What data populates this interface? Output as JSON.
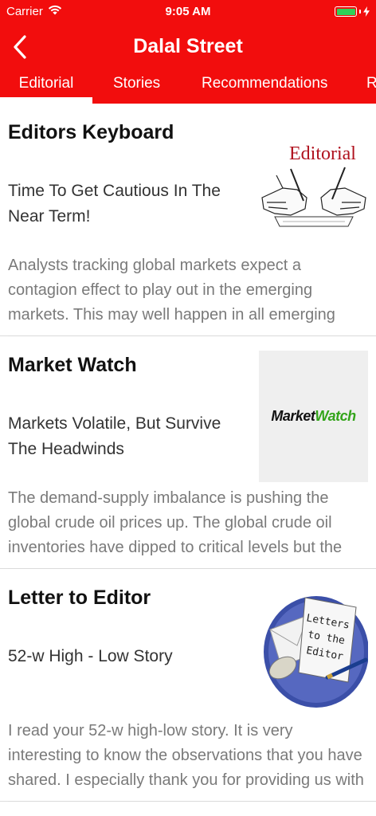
{
  "status_bar": {
    "carrier": "Carrier",
    "time": "9:05 AM"
  },
  "header": {
    "title": "Dalal Street",
    "background_color": "#f20d0d"
  },
  "tabs": [
    {
      "label": "Editorial",
      "active": true
    },
    {
      "label": "Stories",
      "active": false
    },
    {
      "label": "Recommendations",
      "active": false
    },
    {
      "label": "R",
      "active": false
    }
  ],
  "articles": [
    {
      "section": "Editors Keyboard",
      "headline": "Time To Get Cautious In The Near Term!",
      "snippet": "Analysts tracking global markets expect a contagion effect to play out in the emerging markets. This may well happen in all emerging markets, thus damaging",
      "thumbnail_text": "Editorial"
    },
    {
      "section": "Market Watch",
      "headline": "Markets Volatile, But Survive The Headwinds",
      "snippet": "The demand-supply imbalance is pushing the global crude oil prices up. The global crude oil inventories have dipped to critical levels but the demand has",
      "thumbnail_text_a": "Market",
      "thumbnail_text_b": "Watch"
    },
    {
      "section": "Letter to Editor",
      "headline": "52-w High - Low Story",
      "snippet": "I read your 52-w high-low story. It is very interesting to know the observations that you have shared. I especially thank you for providing us with the list of",
      "thumbnail_text_1": "Letters",
      "thumbnail_text_2": "to the",
      "thumbnail_text_3": "Editor"
    }
  ]
}
